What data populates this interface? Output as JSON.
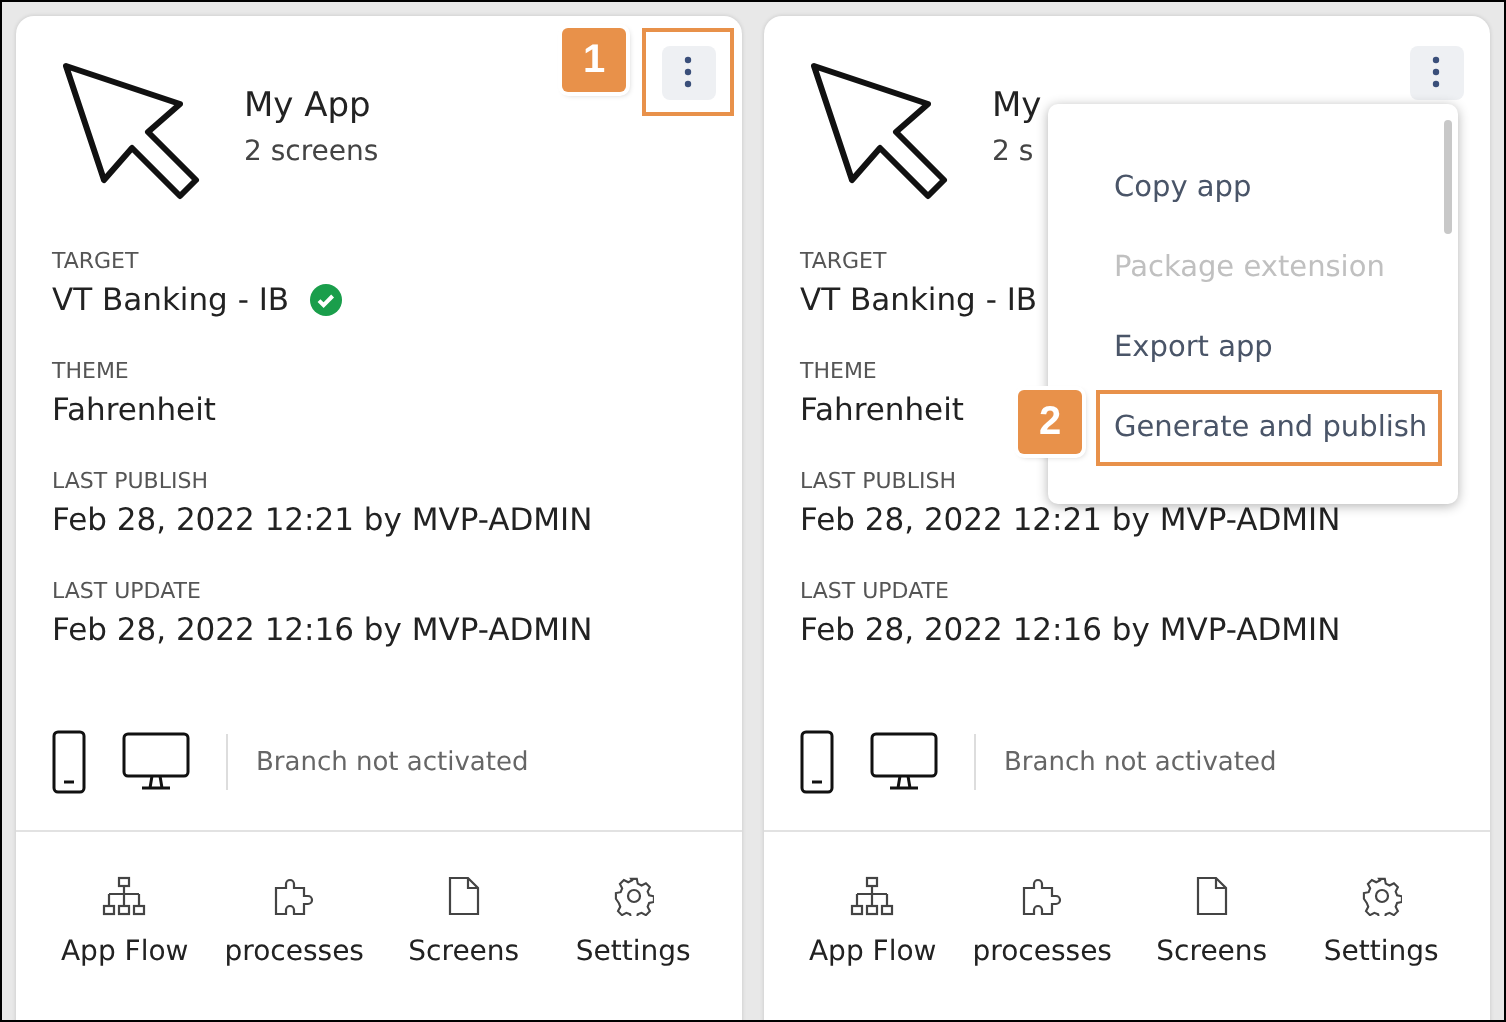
{
  "cards": [
    {
      "title": "My App",
      "subtitle": "2 screens",
      "kebab_highlighted": true,
      "callout": "1",
      "details": [
        {
          "label": "TARGET",
          "value": "VT Banking - IB",
          "verified": true
        },
        {
          "label": "THEME",
          "value": "Fahrenheit"
        },
        {
          "label": "LAST PUBLISH",
          "value": "Feb 28, 2022 12:21 by MVP-ADMIN"
        },
        {
          "label": "LAST UPDATE",
          "value": "Feb 28, 2022 12:16 by MVP-ADMIN"
        }
      ],
      "branch_status": "Branch not activated",
      "actions": [
        {
          "kind": "flow",
          "label": "App Flow"
        },
        {
          "kind": "processes",
          "label": "processes"
        },
        {
          "kind": "screens",
          "label": "Screens"
        },
        {
          "kind": "settings",
          "label": "Settings"
        }
      ]
    },
    {
      "title": "My",
      "subtitle": "2 s",
      "kebab_highlighted": false,
      "details": [
        {
          "label": "TARGET",
          "value": "VT Banking - IB"
        },
        {
          "label": "THEME",
          "value": "Fahrenheit"
        },
        {
          "label": "LAST PUBLISH",
          "value": "Feb 28, 2022 12:21 by MVP-ADMIN"
        },
        {
          "label": "LAST UPDATE",
          "value": "Feb 28, 2022 12:16 by MVP-ADMIN"
        }
      ],
      "branch_status": "Branch not activated",
      "actions": [
        {
          "kind": "flow",
          "label": "App Flow"
        },
        {
          "kind": "processes",
          "label": "processes"
        },
        {
          "kind": "screens",
          "label": "Screens"
        },
        {
          "kind": "settings",
          "label": "Settings"
        }
      ],
      "menu": {
        "items": [
          {
            "label": "Copy app",
            "disabled": false,
            "highlighted": false
          },
          {
            "label": "Package extension",
            "disabled": true,
            "highlighted": false
          },
          {
            "label": "Export app",
            "disabled": false,
            "highlighted": false
          },
          {
            "label": "Generate and publish",
            "disabled": false,
            "highlighted": true,
            "callout": "2"
          }
        ]
      }
    }
  ]
}
